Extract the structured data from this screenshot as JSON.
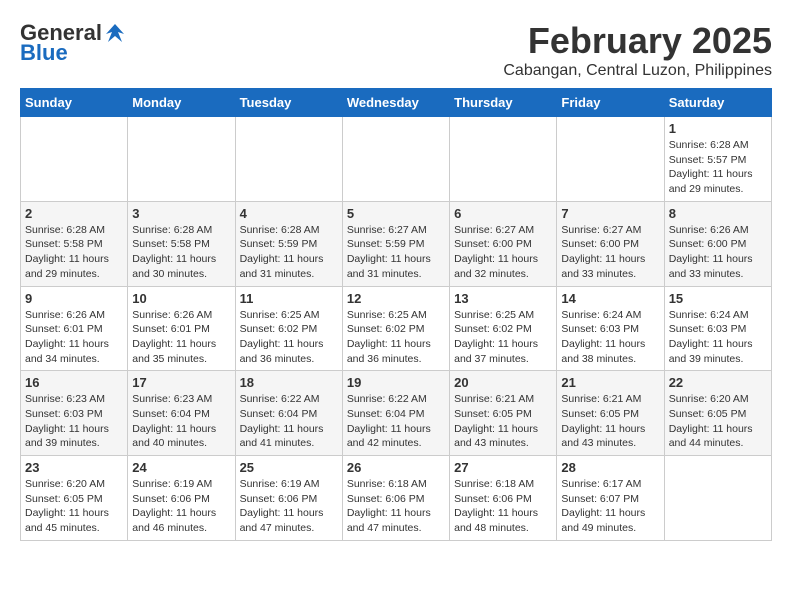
{
  "header": {
    "logo_general": "General",
    "logo_blue": "Blue",
    "month_title": "February 2025",
    "location": "Cabangan, Central Luzon, Philippines"
  },
  "days_of_week": [
    "Sunday",
    "Monday",
    "Tuesday",
    "Wednesday",
    "Thursday",
    "Friday",
    "Saturday"
  ],
  "weeks": [
    [
      {
        "day": "",
        "info": ""
      },
      {
        "day": "",
        "info": ""
      },
      {
        "day": "",
        "info": ""
      },
      {
        "day": "",
        "info": ""
      },
      {
        "day": "",
        "info": ""
      },
      {
        "day": "",
        "info": ""
      },
      {
        "day": "1",
        "info": "Sunrise: 6:28 AM\nSunset: 5:57 PM\nDaylight: 11 hours and 29 minutes."
      }
    ],
    [
      {
        "day": "2",
        "info": "Sunrise: 6:28 AM\nSunset: 5:58 PM\nDaylight: 11 hours and 29 minutes."
      },
      {
        "day": "3",
        "info": "Sunrise: 6:28 AM\nSunset: 5:58 PM\nDaylight: 11 hours and 30 minutes."
      },
      {
        "day": "4",
        "info": "Sunrise: 6:28 AM\nSunset: 5:59 PM\nDaylight: 11 hours and 31 minutes."
      },
      {
        "day": "5",
        "info": "Sunrise: 6:27 AM\nSunset: 5:59 PM\nDaylight: 11 hours and 31 minutes."
      },
      {
        "day": "6",
        "info": "Sunrise: 6:27 AM\nSunset: 6:00 PM\nDaylight: 11 hours and 32 minutes."
      },
      {
        "day": "7",
        "info": "Sunrise: 6:27 AM\nSunset: 6:00 PM\nDaylight: 11 hours and 33 minutes."
      },
      {
        "day": "8",
        "info": "Sunrise: 6:26 AM\nSunset: 6:00 PM\nDaylight: 11 hours and 33 minutes."
      }
    ],
    [
      {
        "day": "9",
        "info": "Sunrise: 6:26 AM\nSunset: 6:01 PM\nDaylight: 11 hours and 34 minutes."
      },
      {
        "day": "10",
        "info": "Sunrise: 6:26 AM\nSunset: 6:01 PM\nDaylight: 11 hours and 35 minutes."
      },
      {
        "day": "11",
        "info": "Sunrise: 6:25 AM\nSunset: 6:02 PM\nDaylight: 11 hours and 36 minutes."
      },
      {
        "day": "12",
        "info": "Sunrise: 6:25 AM\nSunset: 6:02 PM\nDaylight: 11 hours and 36 minutes."
      },
      {
        "day": "13",
        "info": "Sunrise: 6:25 AM\nSunset: 6:02 PM\nDaylight: 11 hours and 37 minutes."
      },
      {
        "day": "14",
        "info": "Sunrise: 6:24 AM\nSunset: 6:03 PM\nDaylight: 11 hours and 38 minutes."
      },
      {
        "day": "15",
        "info": "Sunrise: 6:24 AM\nSunset: 6:03 PM\nDaylight: 11 hours and 39 minutes."
      }
    ],
    [
      {
        "day": "16",
        "info": "Sunrise: 6:23 AM\nSunset: 6:03 PM\nDaylight: 11 hours and 39 minutes."
      },
      {
        "day": "17",
        "info": "Sunrise: 6:23 AM\nSunset: 6:04 PM\nDaylight: 11 hours and 40 minutes."
      },
      {
        "day": "18",
        "info": "Sunrise: 6:22 AM\nSunset: 6:04 PM\nDaylight: 11 hours and 41 minutes."
      },
      {
        "day": "19",
        "info": "Sunrise: 6:22 AM\nSunset: 6:04 PM\nDaylight: 11 hours and 42 minutes."
      },
      {
        "day": "20",
        "info": "Sunrise: 6:21 AM\nSunset: 6:05 PM\nDaylight: 11 hours and 43 minutes."
      },
      {
        "day": "21",
        "info": "Sunrise: 6:21 AM\nSunset: 6:05 PM\nDaylight: 11 hours and 43 minutes."
      },
      {
        "day": "22",
        "info": "Sunrise: 6:20 AM\nSunset: 6:05 PM\nDaylight: 11 hours and 44 minutes."
      }
    ],
    [
      {
        "day": "23",
        "info": "Sunrise: 6:20 AM\nSunset: 6:05 PM\nDaylight: 11 hours and 45 minutes."
      },
      {
        "day": "24",
        "info": "Sunrise: 6:19 AM\nSunset: 6:06 PM\nDaylight: 11 hours and 46 minutes."
      },
      {
        "day": "25",
        "info": "Sunrise: 6:19 AM\nSunset: 6:06 PM\nDaylight: 11 hours and 47 minutes."
      },
      {
        "day": "26",
        "info": "Sunrise: 6:18 AM\nSunset: 6:06 PM\nDaylight: 11 hours and 47 minutes."
      },
      {
        "day": "27",
        "info": "Sunrise: 6:18 AM\nSunset: 6:06 PM\nDaylight: 11 hours and 48 minutes."
      },
      {
        "day": "28",
        "info": "Sunrise: 6:17 AM\nSunset: 6:07 PM\nDaylight: 11 hours and 49 minutes."
      },
      {
        "day": "",
        "info": ""
      }
    ]
  ]
}
